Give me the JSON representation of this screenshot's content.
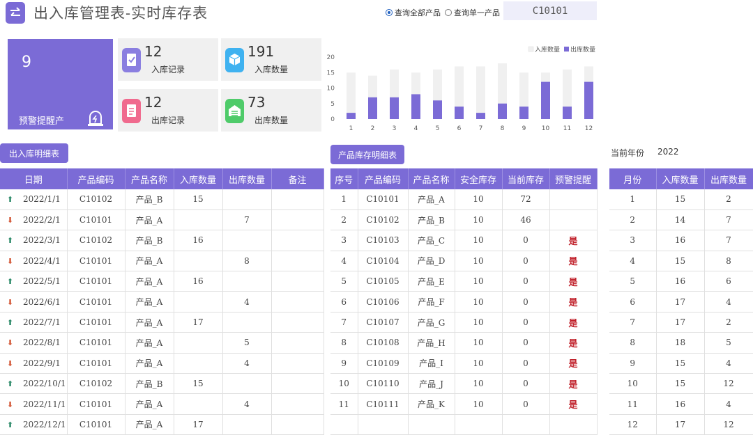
{
  "header": {
    "title": "出入库管理表-实时库存表",
    "radio_all": "查询全部产品",
    "radio_single": "查询单一产品",
    "product_code": "C10101"
  },
  "kpi": {
    "warning_count": "9",
    "warning_label": "预警提醒产",
    "in_records": "12",
    "in_records_label": "入库记录",
    "in_qty": "191",
    "in_qty_label": "入库数量",
    "out_records": "12",
    "out_records_label": "出库记录",
    "out_qty": "73",
    "out_qty_label": "出库数量"
  },
  "chart_data": {
    "type": "bar",
    "categories": [
      "1",
      "2",
      "3",
      "4",
      "5",
      "6",
      "7",
      "8",
      "9",
      "10",
      "11",
      "12"
    ],
    "series": [
      {
        "name": "入库数量",
        "values": [
          15,
          14,
          16,
          15,
          16,
          17,
          17,
          18,
          15,
          15,
          16,
          17
        ],
        "color": "#f0f0f0"
      },
      {
        "name": "出库数量",
        "values": [
          2,
          7,
          7,
          8,
          6,
          4,
          2,
          5,
          4,
          12,
          4,
          12
        ],
        "color": "#7b6bd6"
      }
    ],
    "yticks": [
      "0",
      "5",
      "10",
      "15",
      "20"
    ],
    "ylim": [
      0,
      20
    ],
    "legend": "top-right",
    "grid": false
  },
  "sections": {
    "detail_btn": "出入库明细表",
    "stock_btn": "产品库存明细表",
    "year_label": "当前年份",
    "year_value": "2022"
  },
  "detail_table": {
    "headers": [
      "日期",
      "产品编码",
      "产品名称",
      "入库数量",
      "出库数量",
      "备注"
    ],
    "rows": [
      {
        "dir": "in",
        "date": "2022/1/1",
        "code": "C10102",
        "name": "产品_B",
        "in": "15",
        "out": "",
        "note": ""
      },
      {
        "dir": "out",
        "date": "2022/2/1",
        "code": "C10101",
        "name": "产品_A",
        "in": "",
        "out": "7",
        "note": ""
      },
      {
        "dir": "in",
        "date": "2022/3/1",
        "code": "C10102",
        "name": "产品_B",
        "in": "16",
        "out": "",
        "note": ""
      },
      {
        "dir": "out",
        "date": "2022/4/1",
        "code": "C10101",
        "name": "产品_A",
        "in": "",
        "out": "8",
        "note": ""
      },
      {
        "dir": "in",
        "date": "2022/5/1",
        "code": "C10101",
        "name": "产品_A",
        "in": "16",
        "out": "",
        "note": ""
      },
      {
        "dir": "out",
        "date": "2022/6/1",
        "code": "C10101",
        "name": "产品_A",
        "in": "",
        "out": "4",
        "note": ""
      },
      {
        "dir": "in",
        "date": "2022/7/1",
        "code": "C10101",
        "name": "产品_A",
        "in": "17",
        "out": "",
        "note": ""
      },
      {
        "dir": "out",
        "date": "2022/8/1",
        "code": "C10101",
        "name": "产品_A",
        "in": "",
        "out": "5",
        "note": ""
      },
      {
        "dir": "out",
        "date": "2022/9/1",
        "code": "C10101",
        "name": "产品_A",
        "in": "",
        "out": "4",
        "note": ""
      },
      {
        "dir": "in",
        "date": "2022/10/1",
        "code": "C10102",
        "name": "产品_B",
        "in": "15",
        "out": "",
        "note": ""
      },
      {
        "dir": "out",
        "date": "2022/11/1",
        "code": "C10101",
        "name": "产品_A",
        "in": "",
        "out": "4",
        "note": ""
      },
      {
        "dir": "in",
        "date": "2022/12/1",
        "code": "C10101",
        "name": "产品_A",
        "in": "17",
        "out": "",
        "note": ""
      }
    ]
  },
  "stock_table": {
    "headers": [
      "序号",
      "产品编码",
      "产品名称",
      "安全库存",
      "当前库存",
      "预警提醒"
    ],
    "rows": [
      {
        "no": "1",
        "code": "C10101",
        "name": "产品_A",
        "safe": "10",
        "cur": "72",
        "alert": ""
      },
      {
        "no": "2",
        "code": "C10102",
        "name": "产品_B",
        "safe": "10",
        "cur": "46",
        "alert": ""
      },
      {
        "no": "3",
        "code": "C10103",
        "name": "产品_C",
        "safe": "10",
        "cur": "0",
        "alert": "是"
      },
      {
        "no": "4",
        "code": "C10104",
        "name": "产品_D",
        "safe": "10",
        "cur": "0",
        "alert": "是"
      },
      {
        "no": "5",
        "code": "C10105",
        "name": "产品_E",
        "safe": "10",
        "cur": "0",
        "alert": "是"
      },
      {
        "no": "6",
        "code": "C10106",
        "name": "产品_F",
        "safe": "10",
        "cur": "0",
        "alert": "是"
      },
      {
        "no": "7",
        "code": "C10107",
        "name": "产品_G",
        "safe": "10",
        "cur": "0",
        "alert": "是"
      },
      {
        "no": "8",
        "code": "C10108",
        "name": "产品_H",
        "safe": "10",
        "cur": "0",
        "alert": "是"
      },
      {
        "no": "9",
        "code": "C10109",
        "name": "产品_I",
        "safe": "10",
        "cur": "0",
        "alert": "是"
      },
      {
        "no": "10",
        "code": "C10110",
        "name": "产品_J",
        "safe": "10",
        "cur": "0",
        "alert": "是"
      },
      {
        "no": "11",
        "code": "C10111",
        "name": "产品_K",
        "safe": "10",
        "cur": "0",
        "alert": "是"
      },
      {
        "no": "",
        "code": "",
        "name": "",
        "safe": "",
        "cur": "",
        "alert": ""
      }
    ]
  },
  "month_table": {
    "headers": [
      "月份",
      "入库数量",
      "出库数量"
    ],
    "rows": [
      [
        "1",
        "15",
        "2"
      ],
      [
        "2",
        "14",
        "7"
      ],
      [
        "3",
        "16",
        "7"
      ],
      [
        "4",
        "15",
        "8"
      ],
      [
        "5",
        "16",
        "6"
      ],
      [
        "6",
        "17",
        "4"
      ],
      [
        "7",
        "17",
        "2"
      ],
      [
        "8",
        "18",
        "5"
      ],
      [
        "9",
        "15",
        "4"
      ],
      [
        "10",
        "15",
        "12"
      ],
      [
        "11",
        "16",
        "4"
      ],
      [
        "12",
        "17",
        "12"
      ]
    ]
  },
  "colors": {
    "accent": "#7b6bd6",
    "alert": "#c0202a",
    "in_arrow": "#2e8b6a",
    "out_arrow": "#d45a3a"
  }
}
